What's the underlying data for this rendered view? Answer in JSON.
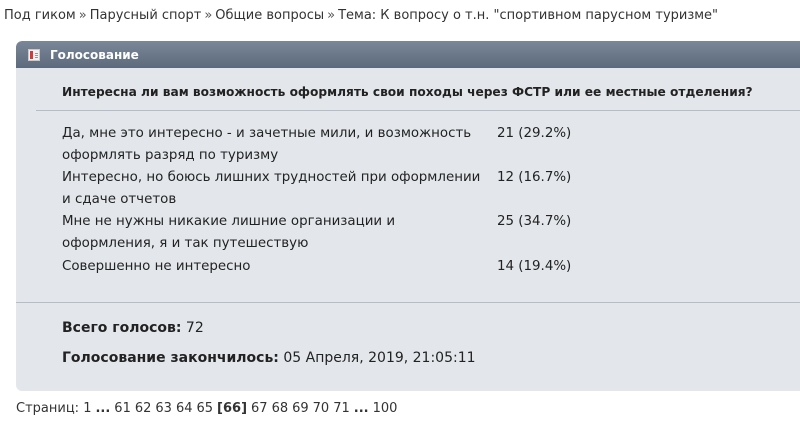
{
  "breadcrumb": {
    "items": [
      "Под гиком",
      "Парусный спорт",
      "Общие вопросы"
    ],
    "separator": "»",
    "topic": "Тема: К вопросу о т.н. \"спортивном парусном туризме\""
  },
  "poll": {
    "header": "Голосование",
    "question": "Интересна ли вам возможность оформлять свои походы через ФСТР или ее местные отделения?",
    "options": [
      {
        "line1": "Да, мне это интересно - и зачетные мили, и возможность",
        "line2": "оформлять разряд по туризму",
        "result": "21 (29.2%)",
        "votes": 21,
        "percent": 29.2
      },
      {
        "line1": "Интересно, но боюсь лишних трудностей при оформлении",
        "line2": "и сдаче отчетов",
        "result": "12 (16.7%)",
        "votes": 12,
        "percent": 16.7
      },
      {
        "line1": "Мне не нужны никакие лишние организации и",
        "line2": "оформления, я и так путешествую",
        "result": "25 (34.7%)",
        "votes": 25,
        "percent": 34.7
      },
      {
        "line1": "Совершенно не интересно",
        "line2": "",
        "result": "14 (19.4%)",
        "votes": 14,
        "percent": 19.4
      }
    ],
    "total_label": "Всего голосов:",
    "total_value": "72",
    "ended_label": "Голосование закончилось:",
    "ended_value": "05 Апреля, 2019, 21:05:11"
  },
  "pagination": {
    "label": "Страниц:",
    "first": "1",
    "ellipsis": "...",
    "pages_before": [
      "61",
      "62",
      "63",
      "64",
      "65"
    ],
    "current": "[66]",
    "pages_after": [
      "67",
      "68",
      "69",
      "70",
      "71"
    ],
    "last": "100"
  },
  "colors": {
    "header_bg": "#6b788a",
    "box_bg": "#e3e7ec",
    "divider": "#b5bcc6"
  }
}
